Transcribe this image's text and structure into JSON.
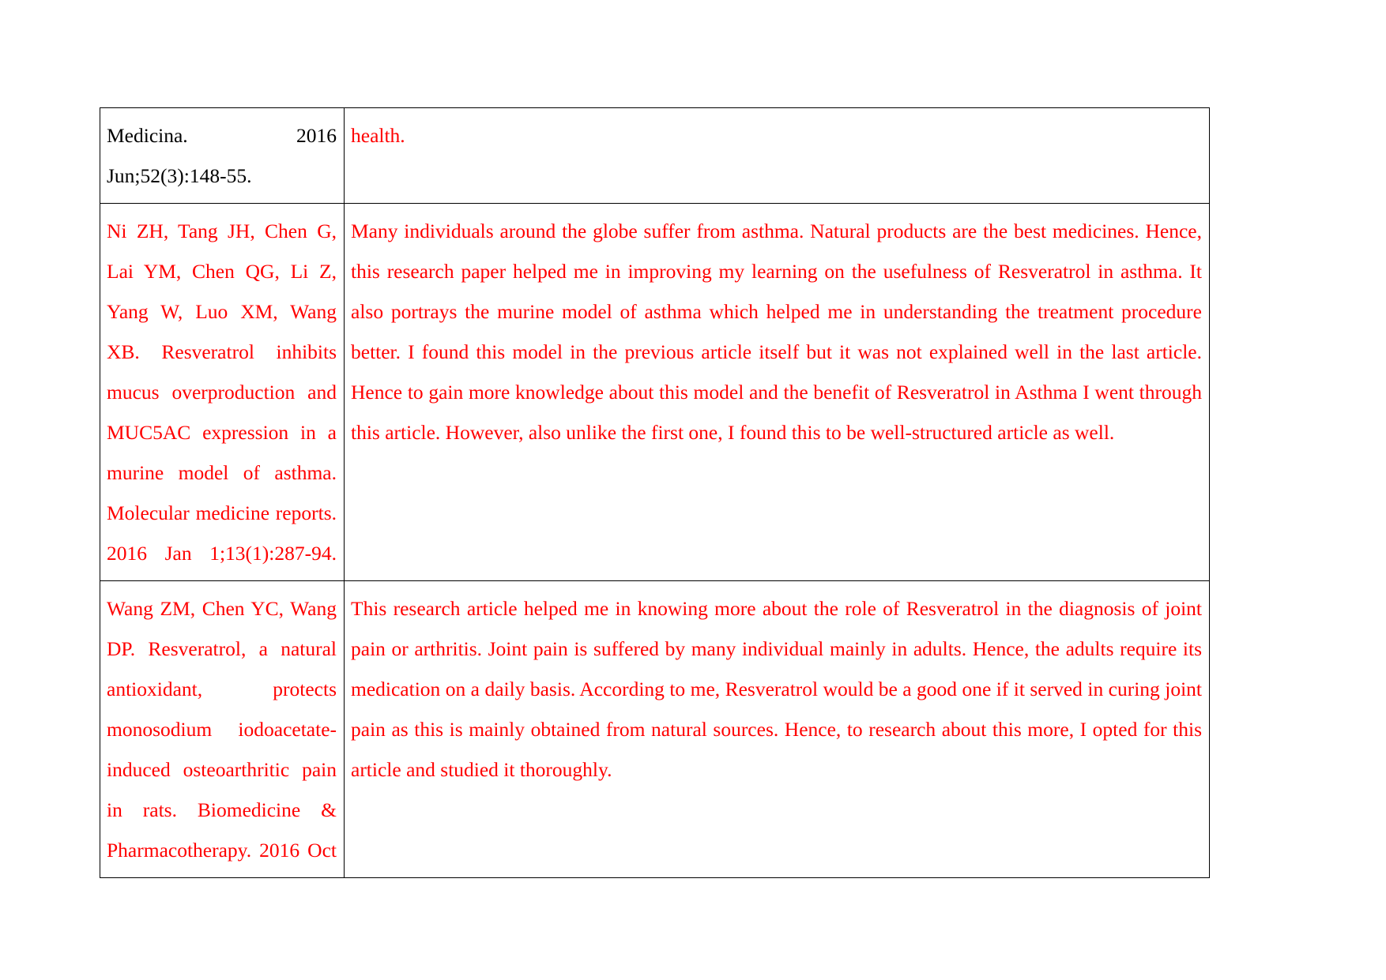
{
  "document": {
    "background_color": "#ffffff",
    "text_color_primary": "#000000",
    "text_color_accent": "#FF0000",
    "table": {
      "columns": 2,
      "rows": [
        {
          "id": "row-1",
          "citation": "Medicina. 2016 Jun;52(3):148-55.",
          "citation_color": "#000000",
          "annotation": "health.",
          "annotation_color": "#FF0000"
        },
        {
          "id": "row-2",
          "citation": "Ni ZH, Tang JH, Chen G, Lai YM, Chen QG, Li Z, Yang W, Luo XM, Wang XB. Resveratrol inhibits mucus overproduction and MUC5AC expression in a murine model of asthma. Molecular medicine reports. 2016 Jan 1;13(1):287-94.",
          "citation_color": "#FF0000",
          "annotation": "Many individuals around the globe suffer from asthma. Natural products are the best medicines. Hence, this research paper helped me in improving my learning on the usefulness of Resveratrol in asthma. It also portrays the murine model of asthma which helped me in understanding the treatment procedure better. I found this model in the previous article itself but it was not explained well in the last article. Hence to gain more knowledge about this model and the benefit of Resveratrol in Asthma I went through this article. However, also unlike the first one, I found this to be well-structured article as well.",
          "annotation_color": "#FF0000"
        },
        {
          "id": "row-3",
          "citation": "Wang ZM, Chen YC, Wang DP. Resveratrol, a natural antioxidant, protects monosodium iodoacetate-induced osteoarthritic pain in rats. Biomedicine & Pharmacotherapy. 2016 Oct",
          "citation_color": "#FF0000",
          "annotation": "This research article helped me in knowing more about the role of Resveratrol in the diagnosis of joint pain or arthritis. Joint pain is suffered by many individual mainly in adults. Hence, the adults require its medication on a daily basis. According to me, Resveratrol would be a good one if it served in curing joint pain as this is mainly obtained from natural sources. Hence, to research about this more, I opted for this article and studied it thoroughly.",
          "annotation_color": "#FF0000"
        }
      ]
    }
  }
}
